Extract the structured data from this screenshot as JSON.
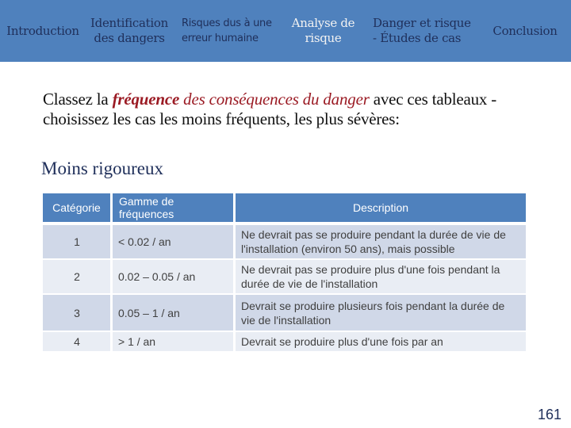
{
  "nav": {
    "items": [
      {
        "label": "Introduction",
        "active": false
      },
      {
        "label": "Identification\ndes dangers",
        "active": false
      },
      {
        "label": "Risques dus à une\nerreur humaine",
        "active": false
      },
      {
        "label": "Analyse de\nrisque",
        "active": true
      },
      {
        "label": "Danger et risque\n- Études de cas",
        "active": false
      },
      {
        "label": "Conclusion",
        "active": false
      }
    ]
  },
  "instructions": {
    "part1": "Classez la ",
    "emphasis_bold": "fréquence",
    "emphasis": " des conséquences du danger",
    "part2": " avec ces tableaux - choisissez les cas les moins fréquents, les plus sévères:"
  },
  "subtitle": "Moins rigoureux",
  "table": {
    "headers": [
      "Catégorie",
      "Gamme de fréquences",
      "Description"
    ],
    "rows": [
      {
        "category": "1",
        "range": "< 0.02 / an",
        "description": "Ne devrait pas se produire pendant la durée de vie de l'installation (environ 50 ans), mais possible"
      },
      {
        "category": "2",
        "range": "0.02 – 0.05 / an",
        "description": "Ne devrait pas se produire plus d'une fois pendant la durée de vie de l'installation"
      },
      {
        "category": "3",
        "range": "0.05 – 1 / an",
        "description": "Devrait se produire plusieurs fois pendant la durée de vie de l'installation"
      },
      {
        "category": "4",
        "range": "> 1 / an",
        "description": "Devrait se produire plus d'une fois par an"
      }
    ]
  },
  "page_number": "161",
  "colors": {
    "nav_background": "#4f81bd",
    "nav_text": "#1f2f5a",
    "nav_active_text": "#f2f2f2",
    "emphasis": "#9b1b24",
    "table_header": "#4f81bd",
    "row_odd": "#d0d8e8",
    "row_even": "#e9edf4"
  }
}
